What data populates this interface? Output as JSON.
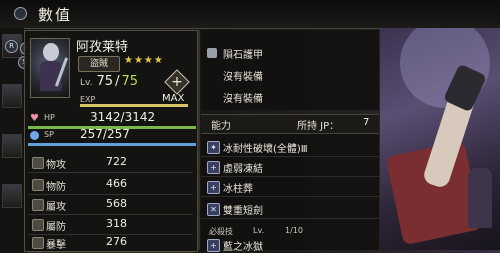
{
  "header": {
    "title": "數值"
  },
  "nav_gems": [
    "R",
    "D",
    "B",
    "S"
  ],
  "character": {
    "name": "阿孜莱特",
    "job": "盜賊",
    "stars": "★★★★",
    "level_label": "Lv.",
    "level": "75",
    "level_sep": "/",
    "level_max": "75",
    "exp_label": "EXP",
    "exp_status": "MAX",
    "exp_fraction": 1.0,
    "hp_label": "HP",
    "hp": "3142/3142",
    "hp_fraction": 1.0,
    "sp_label": "SP",
    "sp": "257/257",
    "sp_fraction": 1.0,
    "plus_label": "+"
  },
  "stats": [
    {
      "name": "物攻",
      "value": "722"
    },
    {
      "name": "物防",
      "value": "466"
    },
    {
      "name": "屬攻",
      "value": "568"
    },
    {
      "name": "屬防",
      "value": "318"
    },
    {
      "name": "暴擊",
      "value": "276"
    }
  ],
  "equipment": [
    {
      "label": "隕石護甲"
    },
    {
      "label": "沒有裝備"
    },
    {
      "label": "沒有裝備"
    }
  ],
  "abilities": {
    "header": "能力",
    "jp_label": "所持 JP：",
    "jp_value": "7",
    "list": [
      {
        "label": "冰耐性破壞(全體)Ⅲ"
      },
      {
        "label": "虛弱凍結"
      },
      {
        "label": "冰柱葬"
      },
      {
        "label": "雙重短劍"
      }
    ],
    "passive_label": "必殺技",
    "passive_lv": "Lv.",
    "passive_value": "1/10",
    "next_skill": "藍之冰獄"
  }
}
